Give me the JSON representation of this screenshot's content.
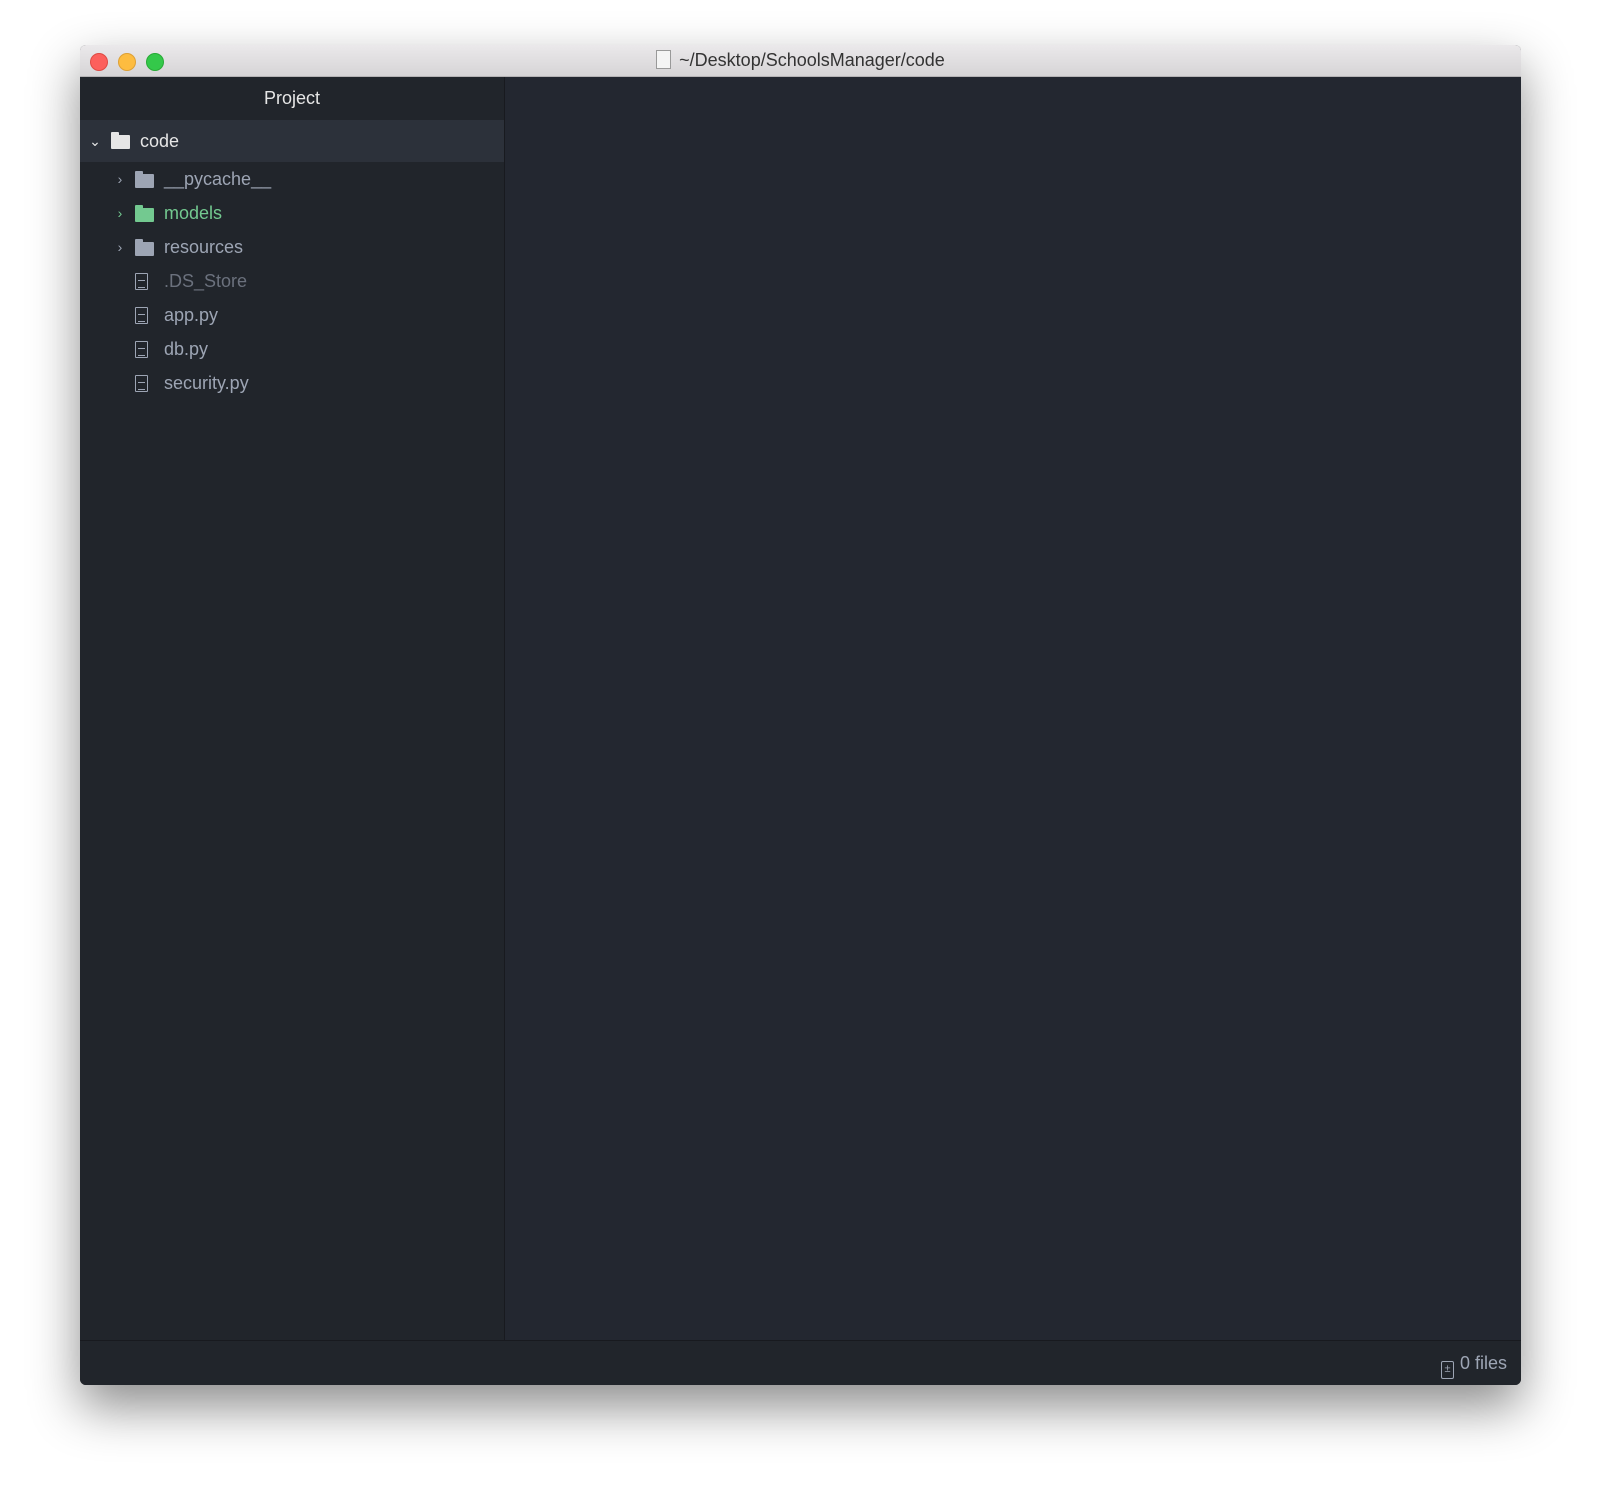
{
  "window": {
    "title": "~/Desktop/SchoolsManager/code"
  },
  "sidebar": {
    "title": "Project",
    "root": {
      "label": "code",
      "expanded": true
    },
    "items": [
      {
        "label": "__pycache__",
        "type": "folder",
        "color": "#9da5b4"
      },
      {
        "label": "models",
        "type": "folder",
        "color": "#73c990"
      },
      {
        "label": "resources",
        "type": "folder",
        "color": "#9da5b4"
      },
      {
        "label": ".DS_Store",
        "type": "file",
        "color": "#6b717d"
      },
      {
        "label": "app.py",
        "type": "file",
        "color": "#9da5b4"
      },
      {
        "label": "db.py",
        "type": "file",
        "color": "#9da5b4"
      },
      {
        "label": "security.py",
        "type": "file",
        "color": "#9da5b4"
      }
    ]
  },
  "status": {
    "files": "0 files"
  }
}
